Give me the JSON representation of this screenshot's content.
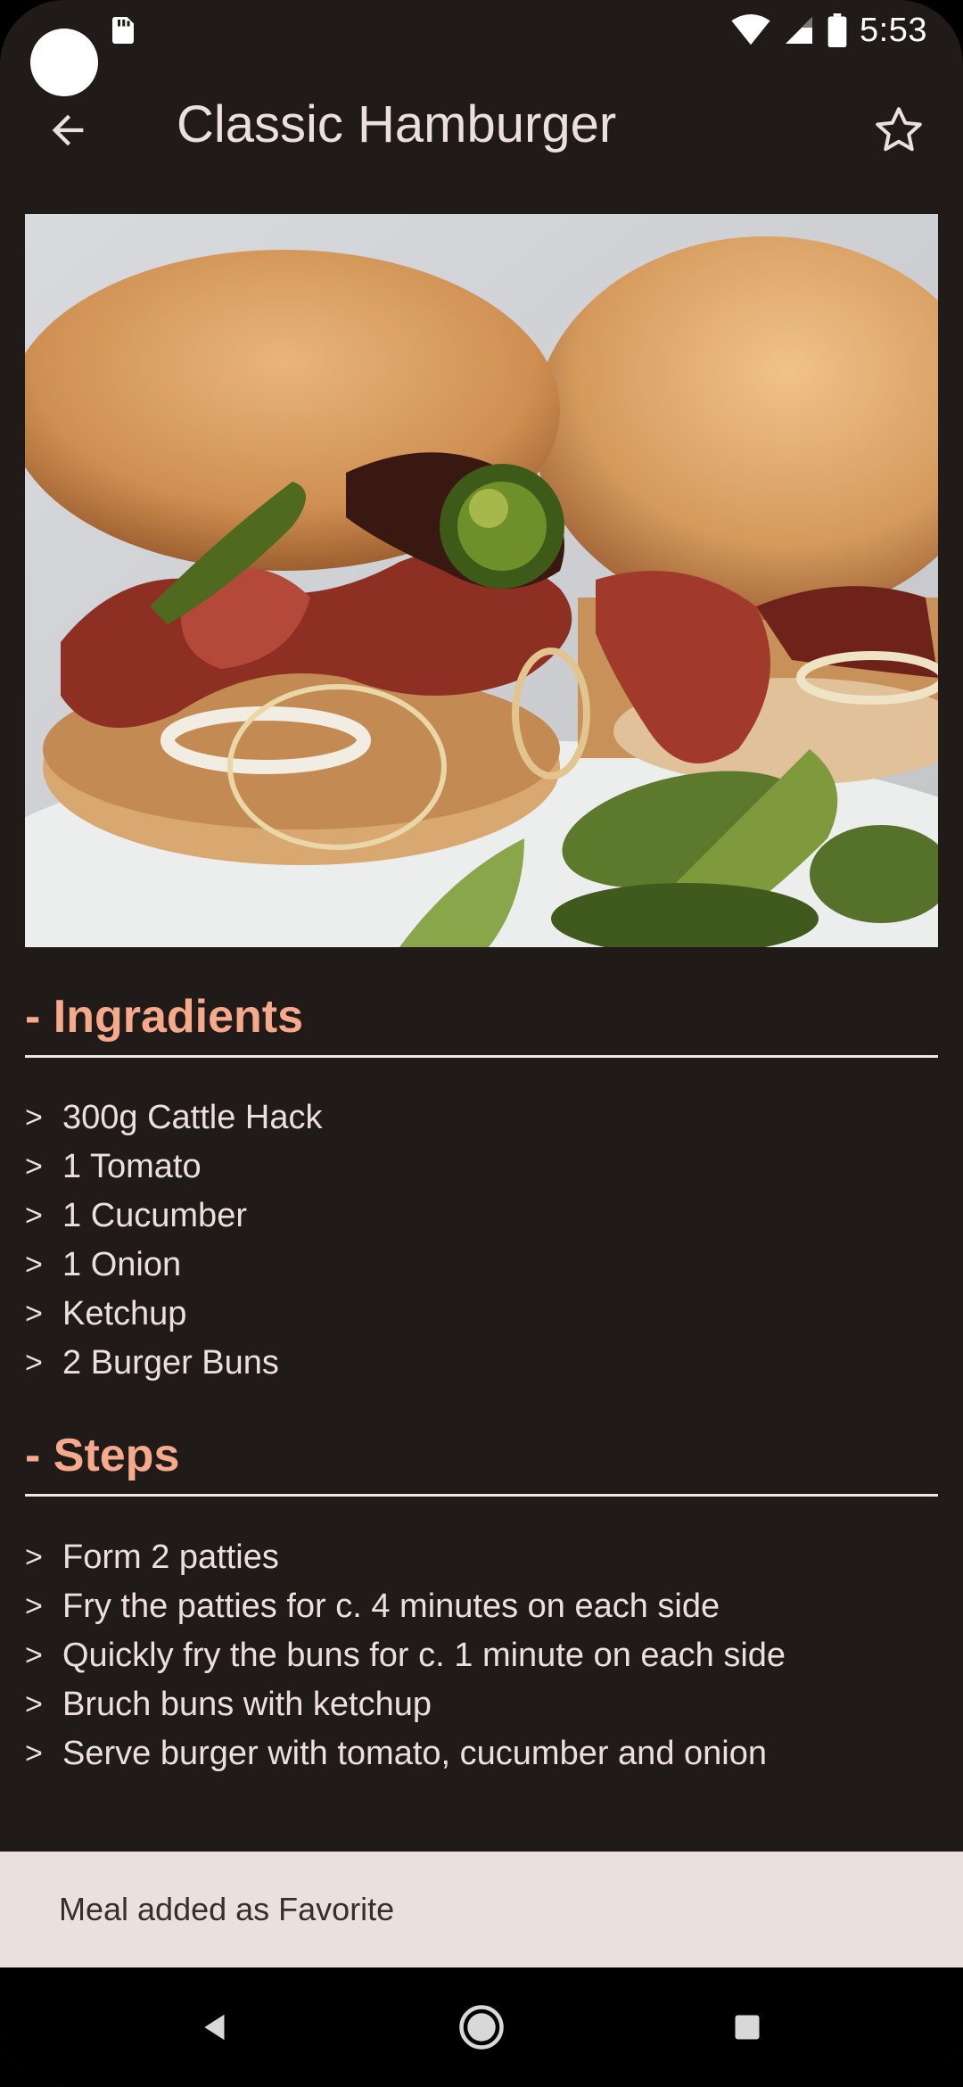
{
  "status_bar": {
    "time": "5:53",
    "icons": [
      "sd-card-icon",
      "wifi-icon",
      "cell-signal-icon",
      "battery-icon"
    ]
  },
  "app_bar": {
    "title": "Classic Hamburger",
    "back_icon": "arrow-back-icon",
    "favorite_icon": "star-outline-icon"
  },
  "image": {
    "subject": "hamburger-photo"
  },
  "ingredients": {
    "heading": "- Ingradients",
    "items": [
      "300g Cattle Hack",
      "1 Tomato",
      "1 Cucumber",
      "1 Onion",
      "Ketchup",
      "2 Burger Buns"
    ]
  },
  "steps": {
    "heading": "- Steps",
    "items": [
      "Form 2 patties",
      "Fry the patties for c. 4 minutes on each side",
      "Quickly fry the buns for c. 1 minute on each side",
      "Bruch buns with ketchup",
      "Serve burger with tomato, cucumber and onion"
    ]
  },
  "bullet": ">",
  "snackbar": {
    "message": "Meal added as Favorite"
  },
  "nav_bar": {
    "icons": [
      "back-triangle-icon",
      "home-circle-icon",
      "recents-square-icon"
    ]
  },
  "colors": {
    "background": "#201a18",
    "accent": "#f7a98c",
    "text": "#ece0dc",
    "snackbar_bg": "#ece0dc"
  }
}
